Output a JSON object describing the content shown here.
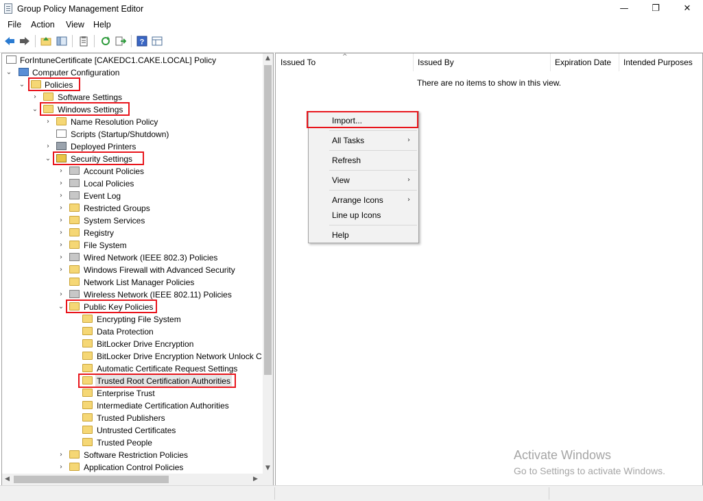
{
  "window": {
    "title": "Group Policy Management Editor",
    "minimize_glyph": "—",
    "maximize_glyph": "❐",
    "close_glyph": "✕"
  },
  "menu": [
    "File",
    "Action",
    "View",
    "Help"
  ],
  "tree": {
    "root": "ForIntuneCertificate [CAKEDC1.CAKE.LOCAL] Policy",
    "computer_configuration": "Computer Configuration",
    "policies": "Policies",
    "software_settings": "Software Settings",
    "windows_settings": "Windows Settings",
    "name_resolution_policy": "Name Resolution Policy",
    "scripts": "Scripts (Startup/Shutdown)",
    "deployed_printers": "Deployed Printers",
    "security_settings": "Security Settings",
    "account_policies": "Account Policies",
    "local_policies": "Local Policies",
    "event_log": "Event Log",
    "restricted_groups": "Restricted Groups",
    "system_services": "System Services",
    "registry": "Registry",
    "file_system": "File System",
    "wired_network": "Wired Network (IEEE 802.3) Policies",
    "windows_firewall": "Windows Firewall with Advanced Security",
    "network_list_manager": "Network List Manager Policies",
    "wireless_network": "Wireless Network (IEEE 802.11) Policies",
    "public_key_policies": "Public Key Policies",
    "encrypting_file_system": "Encrypting File System",
    "data_protection": "Data Protection",
    "bitlocker": "BitLocker Drive Encryption",
    "bitlocker_network_unlock": "BitLocker Drive Encryption Network Unlock C",
    "auto_cert_request": "Automatic Certificate Request Settings",
    "trusted_root": "Trusted Root Certification Authorities",
    "enterprise_trust": "Enterprise Trust",
    "intermediate_ca": "Intermediate Certification Authorities",
    "trusted_publishers": "Trusted Publishers",
    "untrusted_certificates": "Untrusted Certificates",
    "trusted_people": "Trusted People",
    "software_restriction": "Software Restriction Policies",
    "app_control": "Application Control Policies"
  },
  "list": {
    "columns": [
      "Issued To",
      "Issued By",
      "Expiration Date",
      "Intended Purposes"
    ],
    "empty_message": "There are no items to show in this view."
  },
  "context_menu": {
    "import": "Import...",
    "all_tasks": "All Tasks",
    "refresh": "Refresh",
    "view": "View",
    "arrange_icons": "Arrange Icons",
    "line_up_icons": "Line up Icons",
    "help": "Help",
    "submenu_arrow": "›"
  },
  "watermark": {
    "title": "Activate Windows",
    "subtitle": "Go to Settings to activate Windows."
  },
  "colors": {
    "highlight_box": "#e8141b",
    "folder": "#f5d775"
  }
}
